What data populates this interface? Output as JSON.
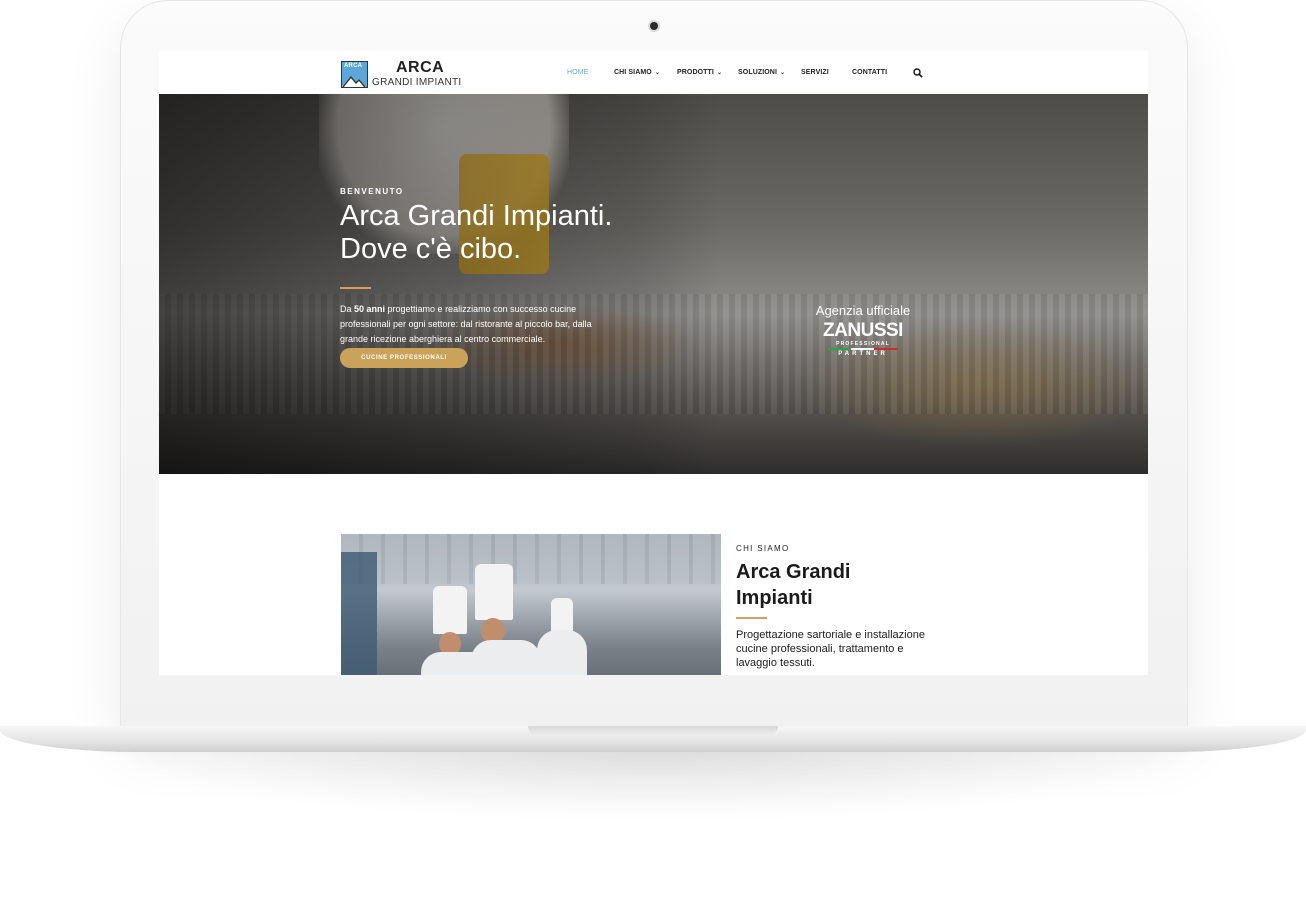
{
  "brand": {
    "mark_text": "ARCA",
    "title": "ARCA",
    "subtitle": "GRANDI IMPIANTI"
  },
  "nav": {
    "items": [
      {
        "label": "HOME",
        "active": true,
        "has_dropdown": false
      },
      {
        "label": "CHI SIAMO",
        "active": false,
        "has_dropdown": true
      },
      {
        "label": "PRODOTTI",
        "active": false,
        "has_dropdown": true
      },
      {
        "label": "SOLUZIONI",
        "active": false,
        "has_dropdown": true
      },
      {
        "label": "SERVIZI",
        "active": false,
        "has_dropdown": false
      },
      {
        "label": "CONTATTI",
        "active": false,
        "has_dropdown": false
      }
    ],
    "dropdown_glyph": "⌄",
    "search_icon": "search-icon"
  },
  "hero": {
    "eyebrow": "BENVENUTO",
    "title_line1": "Arca Grandi Impianti.",
    "title_line2": "Dove c'è cibo.",
    "text_prefix": "Da ",
    "text_highlight": "50 anni",
    "text_suffix": " progettiamo e realizziamo con successo cucine professionali per ogni settore: dal ristorante al piccolo bar, dalla grande ricezione aberghiera al centro commerciale.",
    "button_label": "CUCINE PROFESSIONALI",
    "agency_label": "Agenzia ufficiale",
    "partner_brand": "ZANUSSI",
    "partner_sub": "PROFESSIONAL",
    "partner_tag": "PARTNER"
  },
  "about": {
    "eyebrow": "CHI SIAMO",
    "title_line1": "Arca Grandi",
    "title_line2": "Impianti",
    "text": "Progettazione sartoriale e installazione cucine professionali, trattamento e lavaggio tessuti."
  },
  "colors": {
    "accent_gold": "#caa25a",
    "nav_active": "#6aa9d6",
    "logo_blue": "#5da7d8"
  }
}
